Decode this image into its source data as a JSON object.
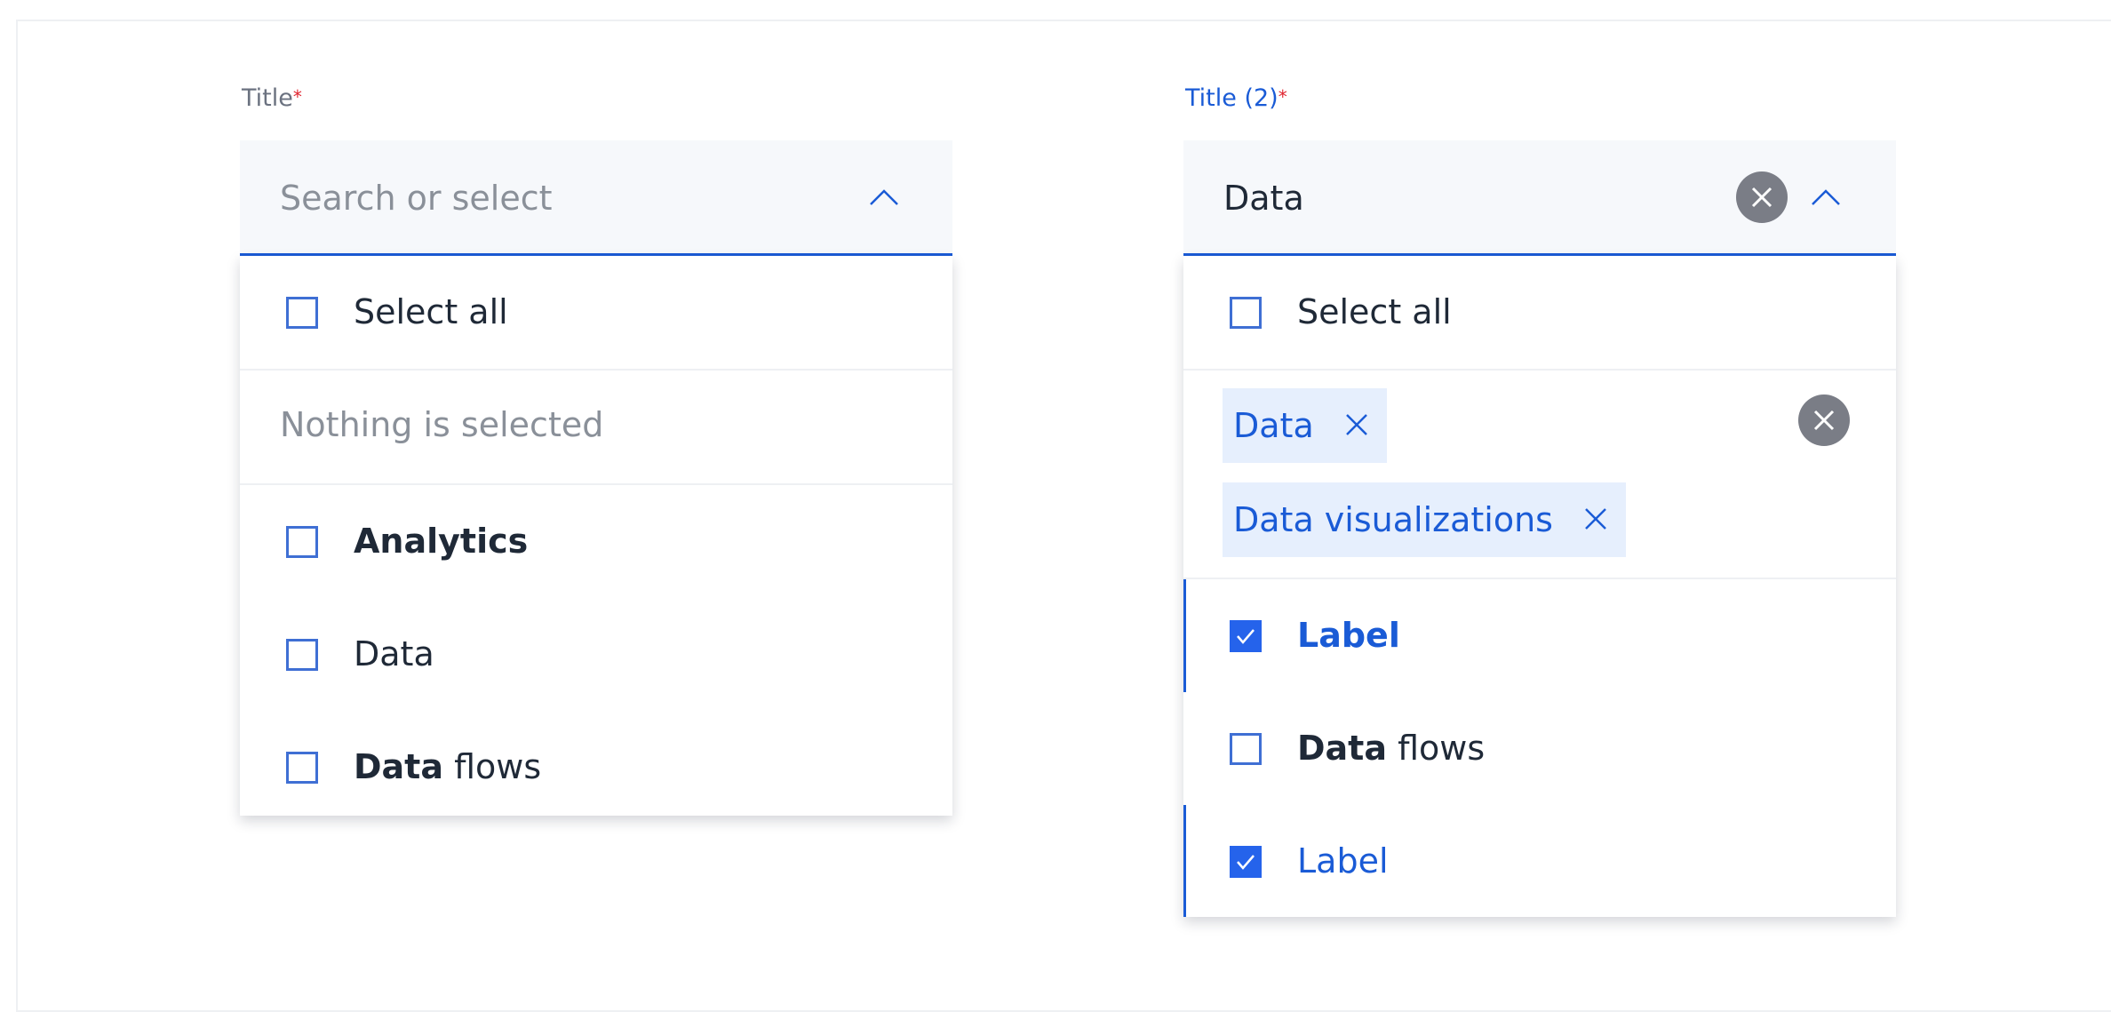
{
  "colors": {
    "accent": "#1a5bd6",
    "checkbox_checked": "#2563eb",
    "required": "#e0242f",
    "tag_bg": "#e6effd",
    "clear_button": "#7a7d86"
  },
  "left_select": {
    "label": "Title",
    "required_mark": "*",
    "placeholder": "Search or select",
    "toggle_icon": "chevron-up-icon",
    "menu": {
      "select_all_label": "Select all",
      "empty_state": "Nothing is selected",
      "options": [
        {
          "label": "Analytics",
          "checked": false
        },
        {
          "label": "Data",
          "checked": false
        },
        {
          "label_bold": "Data",
          "label_rest": " flows",
          "checked": false
        }
      ]
    }
  },
  "right_select": {
    "label": "Title (2)",
    "required_mark": "*",
    "value": "Data",
    "clear_icon": "close-circle-icon",
    "toggle_icon": "chevron-up-icon",
    "menu": {
      "select_all_label": "Select all",
      "selected_tags": [
        {
          "label": "Data",
          "remove_icon": "close-icon"
        },
        {
          "label": "Data visualizations",
          "remove_icon": "close-icon"
        }
      ],
      "clear_all_icon": "close-circle-icon",
      "options": [
        {
          "label": "Label",
          "checked": true
        },
        {
          "label_bold": "Data",
          "label_rest": " flows",
          "checked": false
        },
        {
          "label": "Label",
          "checked": true
        }
      ]
    }
  }
}
